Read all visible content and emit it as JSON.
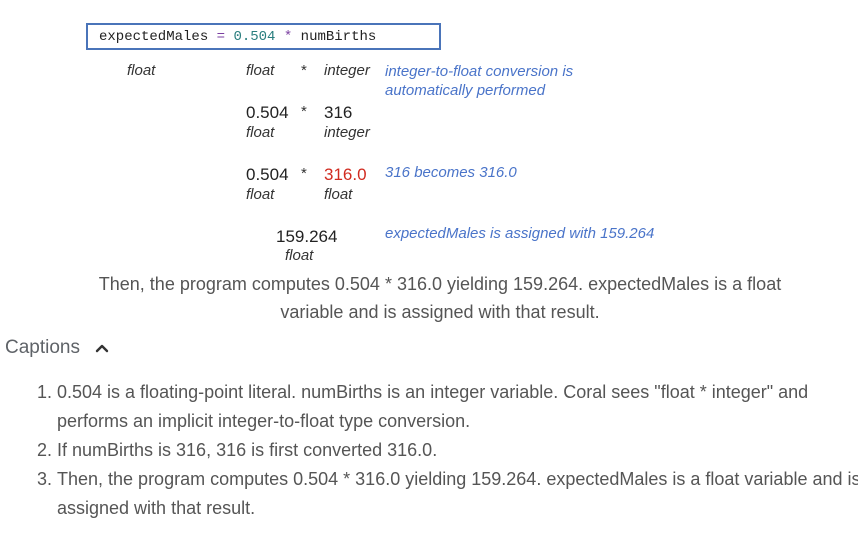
{
  "code": {
    "var": "expectedMales",
    "eq": "=",
    "num": "0.504",
    "op": "*",
    "rhs": "numBirths"
  },
  "row1": {
    "left_type": "float",
    "mid_type": "float",
    "star": "*",
    "right_type": "integer",
    "note_line1": "integer-to-float conversion is",
    "note_line2": "automatically performed"
  },
  "row2": {
    "val1": "0.504",
    "star": "*",
    "val2": "316",
    "type1": "float",
    "type2": "integer"
  },
  "row3": {
    "val1": "0.504",
    "star": "*",
    "val2": "316.0",
    "type1": "float",
    "type2": "float",
    "note": "316 becomes 316.0"
  },
  "row4": {
    "result": "159.264",
    "type": "float",
    "note": "expectedMales is assigned with 159.264"
  },
  "step_caption": {
    "line1": "Then, the program computes 0.504 * 316.0 yielding 159.264. expectedMales is a float",
    "line2": "variable and is assigned with that result."
  },
  "captions": {
    "heading": "Captions",
    "items": [
      "0.504 is a floating-point literal. numBirths is an integer variable. Coral sees \"float * integer\" and performs an implicit integer-to-float type conversion.",
      "If numBirths is 316, 316 is first converted 316.0.",
      "Then, the program computes 0.504 * 316.0 yielding 159.264. expectedMales is a float variable and is assigned with that result."
    ]
  },
  "colors": {
    "code_border": "#4a74b9",
    "note": "#4a74c9",
    "highlight": "#d12a1f"
  }
}
